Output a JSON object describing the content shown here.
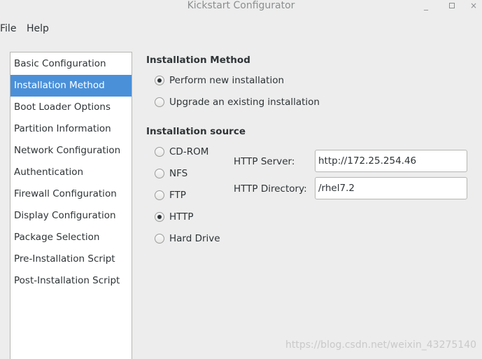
{
  "window": {
    "title": "Kickstart Configurator",
    "minimize_glyph": "_",
    "close_glyph": "×"
  },
  "menubar": {
    "items": [
      "File",
      "Help"
    ]
  },
  "sidebar": {
    "selected": "Installation Method",
    "items": [
      "Basic Configuration",
      "Installation Method",
      "Boot Loader Options",
      "Partition Information",
      "Network Configuration",
      "Authentication",
      "Firewall Configuration",
      "Display Configuration",
      "Package Selection",
      "Pre-Installation Script",
      "Post-Installation Script"
    ]
  },
  "installation_method": {
    "title": "Installation Method",
    "options": [
      {
        "label": "Perform new installation",
        "checked": true
      },
      {
        "label": "Upgrade an existing installation",
        "checked": false
      }
    ]
  },
  "installation_source": {
    "title": "Installation source",
    "options": [
      {
        "label": "CD-ROM",
        "checked": false
      },
      {
        "label": "NFS",
        "checked": false
      },
      {
        "label": "FTP",
        "checked": false
      },
      {
        "label": "HTTP",
        "checked": true
      },
      {
        "label": "Hard Drive",
        "checked": false
      }
    ],
    "http_server": {
      "label": "HTTP Server:",
      "value": "http://172.25.254.46"
    },
    "http_directory": {
      "label": "HTTP Directory:",
      "value": "/rhel7.2"
    }
  },
  "watermark": "https://blog.csdn.net/weixin_43275140",
  "colors": {
    "selection": "#4a90d9",
    "window_bg": "#ededed",
    "text": "#2e3436"
  }
}
